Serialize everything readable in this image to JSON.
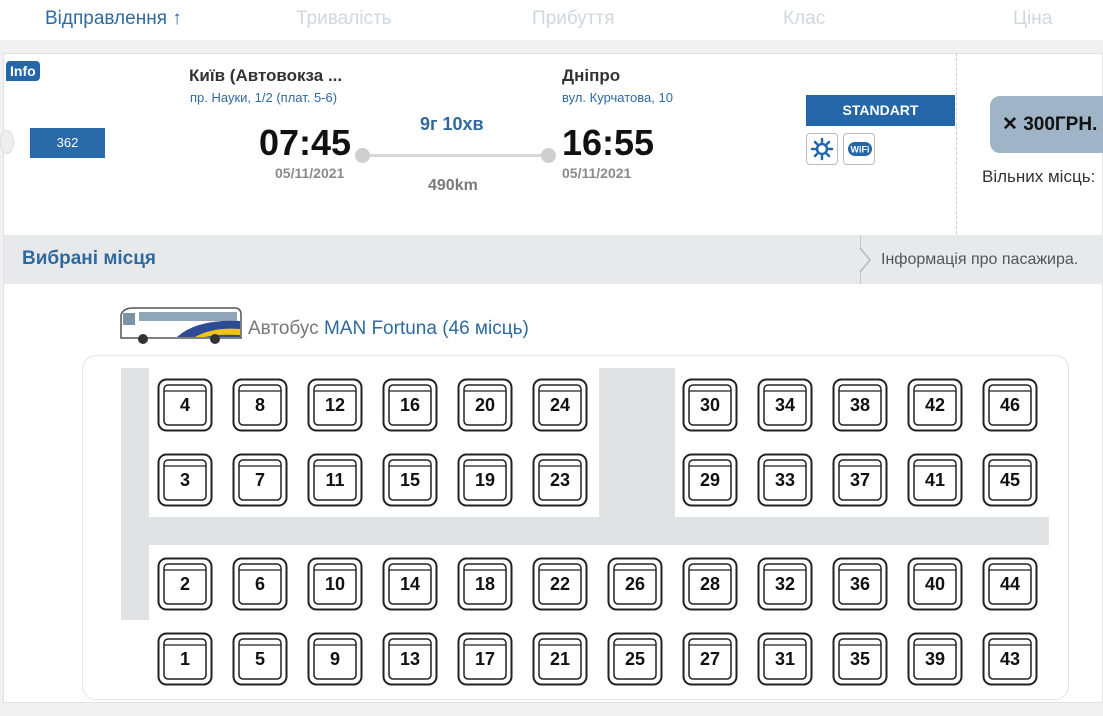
{
  "sort_header": {
    "departure": "Відправлення",
    "departure_arrow": "↑",
    "duration": "Тривалість",
    "arrival": "Прибуття",
    "class": "Клас",
    "price": "Ціна"
  },
  "trip": {
    "info_badge": "Info",
    "route_number": "362",
    "from_city": "Київ (Автовокза ...",
    "from_address": "пр. Науки, 1/2 (плат. 5-6)",
    "departure_time": "07:45",
    "departure_date": "05/11/2021",
    "duration": "9г 10хв",
    "distance": "490km",
    "to_city": "Дніпро",
    "to_address": "вул. Курчатова, 10",
    "arrival_time": "16:55",
    "arrival_date": "05/11/2021",
    "class_label": "STANDART",
    "amenities": [
      "air-conditioning-icon",
      "wifi-icon"
    ],
    "price": "300ГРН.",
    "price_icon": "close-icon",
    "free_seats_label": "Вільних місць:"
  },
  "selection_bar": {
    "title": "Вибрані місця",
    "passenger_info": "Інформація про пасажира."
  },
  "bus": {
    "prefix": "Автобус",
    "model": "MAN Fortuna (46 місць)"
  },
  "seat_rows": [
    [
      "4",
      "8",
      "12",
      "16",
      "20",
      "24",
      "30",
      "34",
      "38",
      "42",
      "46"
    ],
    [
      "3",
      "7",
      "11",
      "15",
      "19",
      "23",
      "29",
      "33",
      "37",
      "41",
      "45"
    ],
    [
      "2",
      "6",
      "10",
      "14",
      "18",
      "22",
      "26",
      "28",
      "32",
      "36",
      "40",
      "44"
    ],
    [
      "1",
      "5",
      "9",
      "13",
      "17",
      "21",
      "25",
      "27",
      "31",
      "35",
      "39",
      "43"
    ]
  ],
  "colors": {
    "brand_blue": "#2466a8",
    "link_blue": "#2f6a9f",
    "price_bg": "#9fb4c6"
  }
}
